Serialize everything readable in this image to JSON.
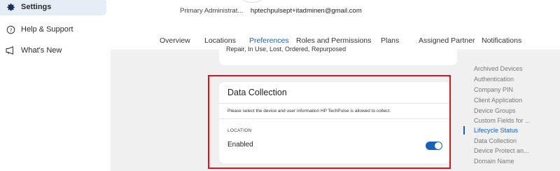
{
  "sidebar": {
    "items": [
      {
        "label": "Settings",
        "icon": "gear-icon",
        "active": true
      },
      {
        "label": "Help & Support",
        "icon": "help-icon"
      },
      {
        "label": "What's New",
        "icon": "megaphone-icon"
      }
    ]
  },
  "header": {
    "role": "Primary Administrat...",
    "email": "hptechpulsept+itadminen@gmail.com"
  },
  "tabs": [
    {
      "label": "Overview"
    },
    {
      "label": "Locations"
    },
    {
      "label": "Preferences",
      "active": true
    },
    {
      "label": "Roles and Permissions"
    },
    {
      "label": "Plans"
    },
    {
      "label": "Assigned Partner"
    },
    {
      "label": "Notifications"
    }
  ],
  "previous_card": {
    "text": "Repair, In Use, Lost, Ordered, Repurposed"
  },
  "data_collection": {
    "title": "Data Collection",
    "description": "Please select the device and user information HP TechPulse is allowed to collect.",
    "section_label": "LOCATION",
    "setting_label": "Enabled",
    "toggle_on": true
  },
  "toc": {
    "items": [
      {
        "label": "Archived Devices"
      },
      {
        "label": "Authentication"
      },
      {
        "label": "Company PIN"
      },
      {
        "label": "Client Application"
      },
      {
        "label": "Device Groups"
      },
      {
        "label": "Custom Fields for ..."
      },
      {
        "label": "Lifecycle Status",
        "active": true
      },
      {
        "label": "Data Collection"
      },
      {
        "label": "Device Protect an..."
      },
      {
        "label": "Domain Name"
      }
    ]
  },
  "colors": {
    "accent": "#1860b8",
    "highlight": "#e0141e",
    "content_bg": "#f0f0f0"
  }
}
